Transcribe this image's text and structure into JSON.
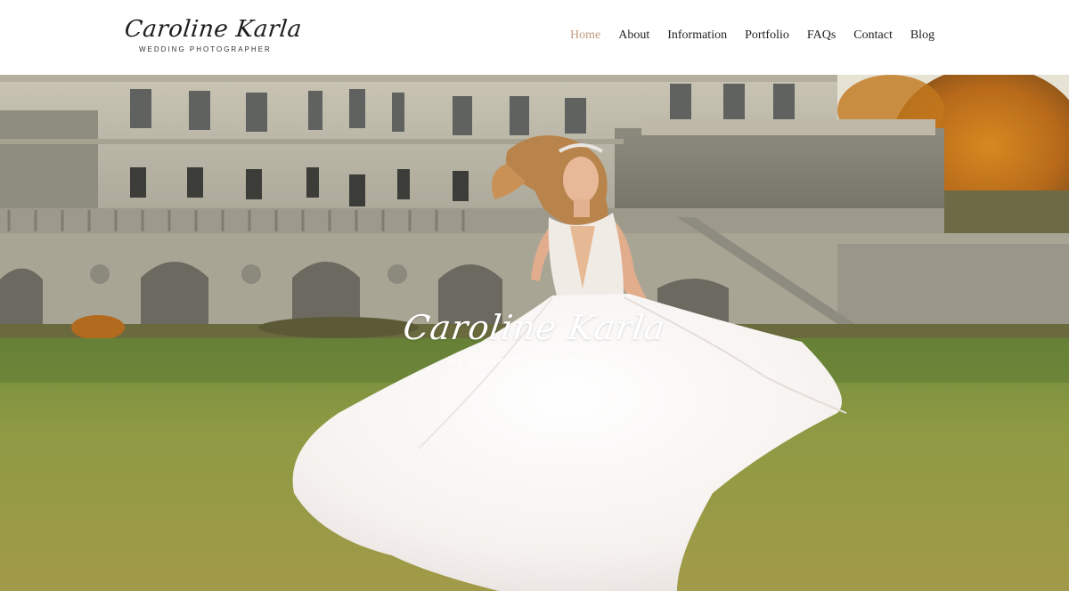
{
  "header": {
    "logo_script": "Caroline Karla",
    "logo_subtitle": "WEDDING PHOTOGRAPHER"
  },
  "nav": {
    "items": [
      {
        "label": "Home",
        "active": true
      },
      {
        "label": "About",
        "active": false
      },
      {
        "label": "Information",
        "active": false
      },
      {
        "label": "Portfolio",
        "active": false
      },
      {
        "label": "FAQs",
        "active": false
      },
      {
        "label": "Contact",
        "active": false
      },
      {
        "label": "Blog",
        "active": false
      }
    ],
    "active_color": "#c29a80",
    "text_color": "#1f1f1f"
  },
  "hero": {
    "title": "Caroline Karla",
    "subtitle": "WEDDING PHOTOGRAPHER",
    "image_description_icon": "bride-photo"
  }
}
